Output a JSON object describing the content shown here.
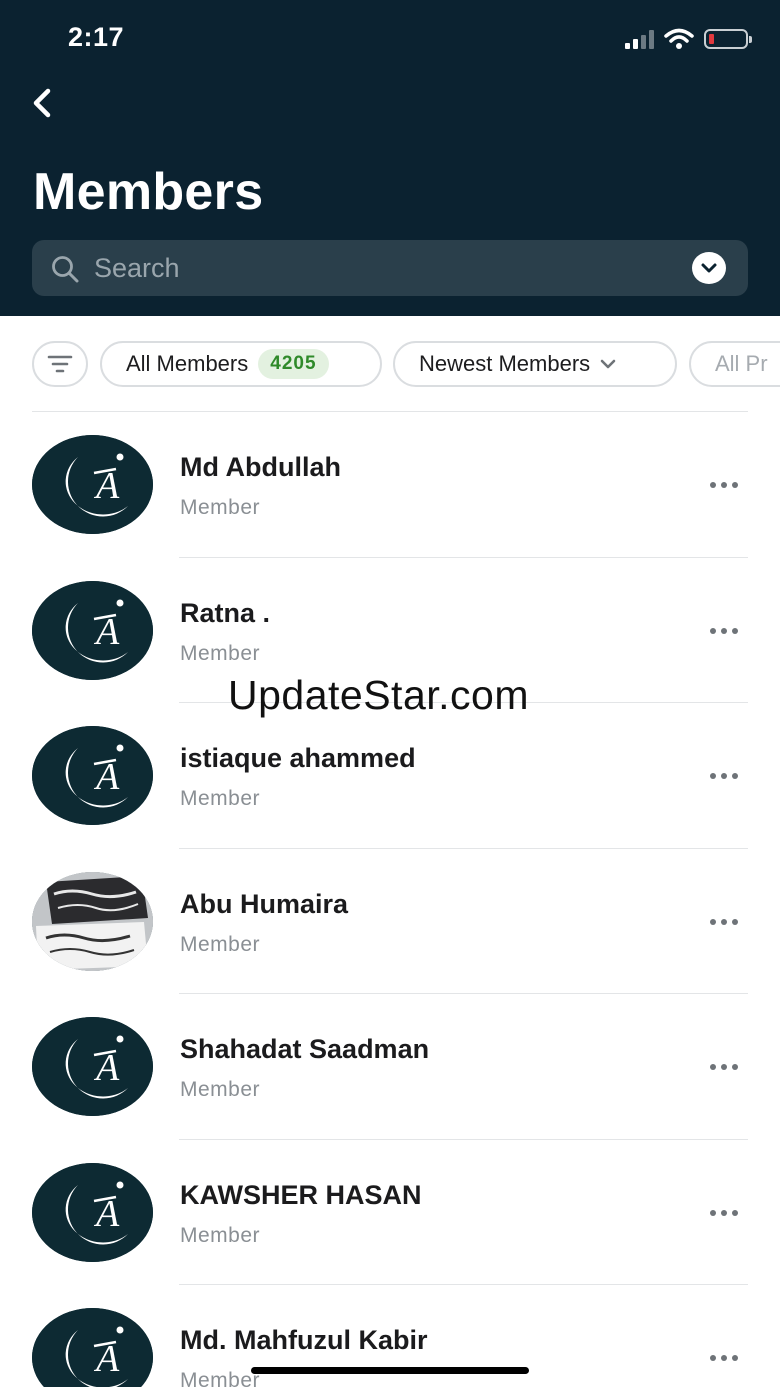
{
  "status_bar": {
    "time": "2:17",
    "icons": [
      "signal-icon",
      "wifi-icon",
      "battery-low-icon"
    ],
    "battery_color": "#e0393e"
  },
  "header": {
    "back_icon": "chevron-left-icon",
    "title": "Members",
    "background": "#0b2230"
  },
  "search": {
    "placeholder": "Search",
    "value": "",
    "toggle_icon": "chevron-down-icon"
  },
  "filters": {
    "filter_icon": "filter-lines-icon",
    "chips": [
      {
        "label": "All Members",
        "count": "4205"
      },
      {
        "label": "Newest Members",
        "icon": "chevron-down-icon"
      },
      {
        "label": "All Pr"
      }
    ]
  },
  "members": [
    {
      "name": "Md Abdullah",
      "role": "Member",
      "avatar": "crescent-logo"
    },
    {
      "name": "Ratna .",
      "role": "Member",
      "avatar": "crescent-logo"
    },
    {
      "name": "istiaque ahammed",
      "role": "Member",
      "avatar": "crescent-logo"
    },
    {
      "name": "Abu Humaira",
      "role": "Member",
      "avatar": "flag-photo"
    },
    {
      "name": "Shahadat Saadman",
      "role": "Member",
      "avatar": "crescent-logo"
    },
    {
      "name": "KAWSHER HASAN",
      "role": "Member",
      "avatar": "crescent-logo"
    },
    {
      "name": "Md. Mahfuzul Kabir",
      "role": "Member",
      "avatar": "crescent-logo"
    }
  ],
  "watermark": "UpdateStar.com",
  "colors": {
    "accent_count": "#2f8a2a",
    "count_bg": "#e3f1e0",
    "avatar_bg": "#0d2a33"
  }
}
